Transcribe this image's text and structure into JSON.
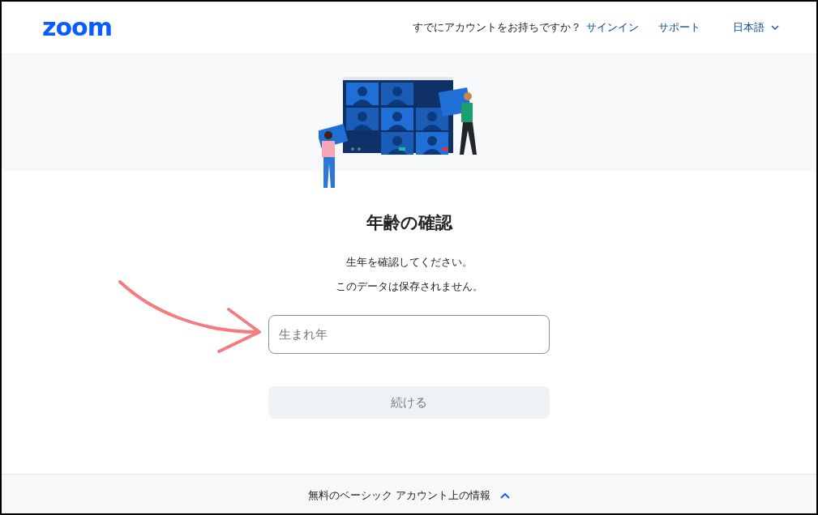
{
  "header": {
    "logo": "zoom",
    "prompt": "すでにアカウントをお持ちですか？",
    "signin_link": "サインイン",
    "support_link": "サポート",
    "language": "日本語"
  },
  "main": {
    "title": "年齢の確認",
    "lines": [
      "生年を確認してください。",
      "このデータは保存されません。"
    ],
    "birth_year_field": {
      "placeholder": "生まれ年"
    },
    "continue_button": {
      "label": "続ける",
      "disabled": true
    }
  },
  "footer": {
    "label": "無料のベーシック アカウント上の情報",
    "expanded": true
  }
}
